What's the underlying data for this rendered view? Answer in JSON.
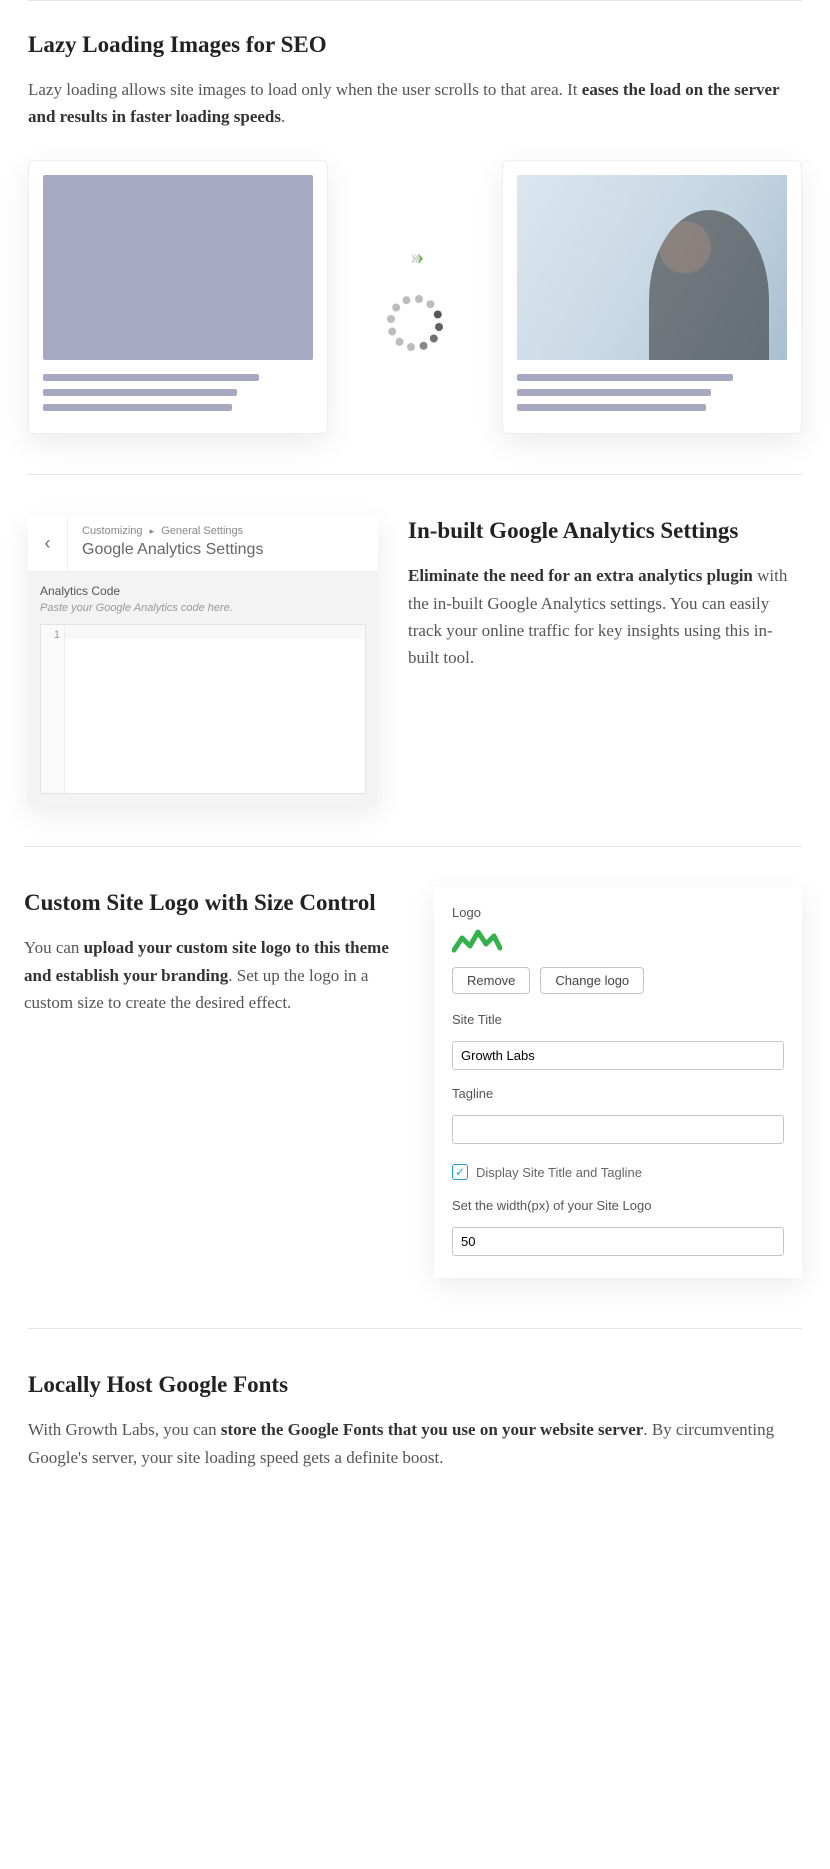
{
  "section1": {
    "heading": "Lazy Loading Images for SEO",
    "body_pre": "Lazy loading allows site images to load only when the user scrolls to that area. It ",
    "body_bold": "eases the load on the server and results in faster loading speeds",
    "body_post": "."
  },
  "section2": {
    "heading": "In-built Google Analytics Settings",
    "body_bold": "Eliminate the need for an extra analytics plugin",
    "body_post": " with the in-built Google Analytics settings. You can easily track your online traffic for key insights using this in-built tool.",
    "mock": {
      "breadcrumb_a": "Customizing",
      "breadcrumb_b": "General Settings",
      "panel_title": "Google Analytics Settings",
      "field_label": "Analytics Code",
      "field_hint": "Paste your Google Analytics code here.",
      "gutter_line": "1"
    }
  },
  "section3": {
    "heading": "Custom Site Logo with Size Control",
    "body_pre": "You can ",
    "body_bold": "upload your custom site logo to this theme and establish your branding",
    "body_post": ". Set up the logo in a custom size to create the desired effect.",
    "mock": {
      "logo_label": "Logo",
      "btn_remove": "Remove",
      "btn_change": "Change logo",
      "site_title_label": "Site Title",
      "site_title_value": "Growth Labs",
      "tagline_label": "Tagline",
      "tagline_value": "",
      "display_chk_label": "Display Site Title and Tagline",
      "width_label": "Set the width(px) of your Site Logo",
      "width_value": "50"
    }
  },
  "section4": {
    "heading": "Locally Host Google Fonts",
    "body_pre": "With Growth Labs, you can ",
    "body_bold": "store the Google Fonts that you use on your website server",
    "body_post": ". By circumventing Google's server, your site loading speed gets a definite boost."
  }
}
